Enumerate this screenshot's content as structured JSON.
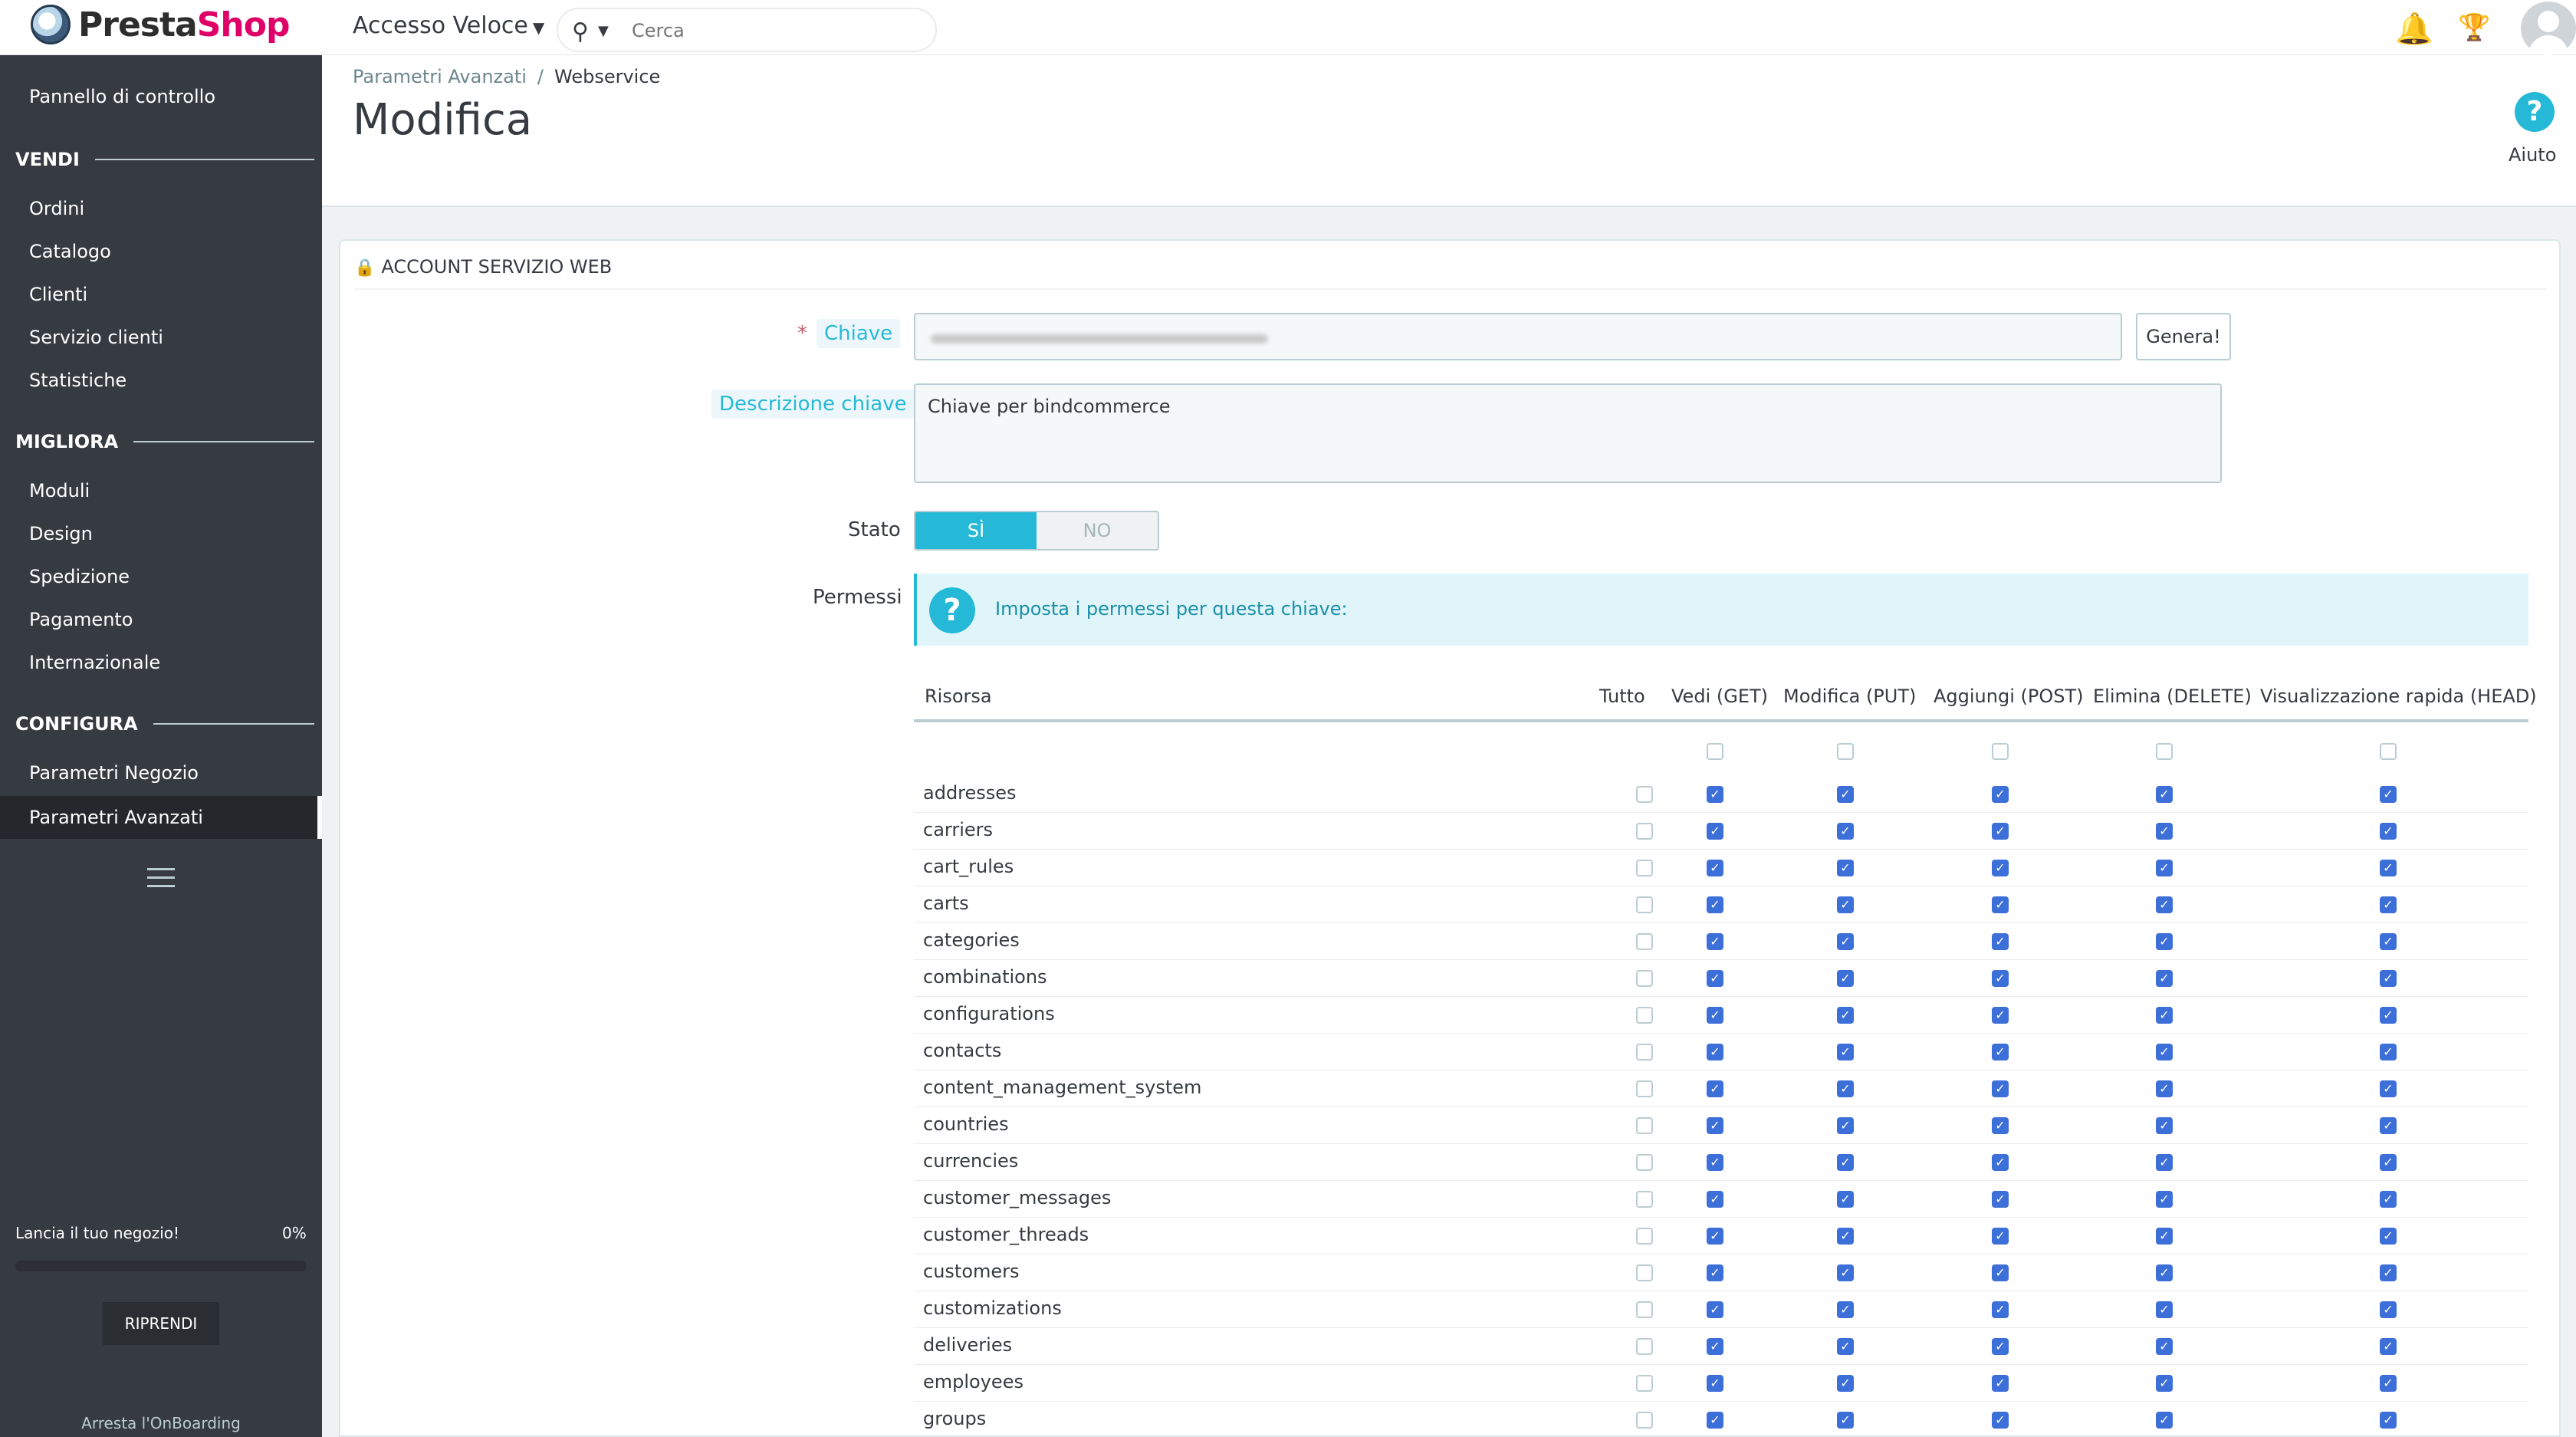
{
  "header": {
    "logo_text_a": "Presta",
    "logo_text_b": "Shop",
    "quick_access": "Accesso Veloce",
    "search_placeholder": "Cerca"
  },
  "sidebar": {
    "dashboard": "Pannello di controllo",
    "sections": [
      {
        "title": "VENDI",
        "items": [
          "Ordini",
          "Catalogo",
          "Clienti",
          "Servizio clienti",
          "Statistiche"
        ]
      },
      {
        "title": "MIGLIORA",
        "items": [
          "Moduli",
          "Design",
          "Spedizione",
          "Pagamento",
          "Internazionale"
        ]
      },
      {
        "title": "CONFIGURA",
        "items": [
          "Parametri Negozio",
          "Parametri Avanzati"
        ]
      }
    ],
    "active_item": "Parametri Avanzati",
    "onboarding": {
      "label": "Lancia il tuo negozio!",
      "percent": "0%",
      "progress": 0,
      "resume": "RIPRENDI",
      "stop": "Arresta l'OnBoarding"
    }
  },
  "page": {
    "breadcrumb": [
      "Parametri Avanzati",
      "Webservice"
    ],
    "title": "Modifica",
    "help": "Aiuto"
  },
  "form": {
    "panel_title": "ACCOUNT SERVIZIO WEB",
    "key_label": "Chiave",
    "generate": "Genera!",
    "desc_label": "Descrizione chiave",
    "desc_value": "Chiave per bindcommerce",
    "status_label": "Stato",
    "status_yes": "SÌ",
    "status_no": "NO",
    "status_value": "yes",
    "perm_label": "Permessi",
    "perm_info": "Imposta i permessi per questa chiave:"
  },
  "permissions": {
    "columns": [
      "Risorsa",
      "Tutto",
      "Vedi (GET)",
      "Modifica (PUT)",
      "Aggiungi (POST)",
      "Elimina (DELETE)",
      "Visualizzazione rapida (HEAD)"
    ],
    "resources": [
      "addresses",
      "carriers",
      "cart_rules",
      "carts",
      "categories",
      "combinations",
      "configurations",
      "contacts",
      "content_management_system",
      "countries",
      "currencies",
      "customer_messages",
      "customer_threads",
      "customers",
      "customizations",
      "deliveries",
      "employees",
      "groups"
    ],
    "row_state": {
      "all": false,
      "get": true,
      "put": true,
      "post": true,
      "delete": true,
      "head": true
    }
  },
  "colors": {
    "accent": "#25b9d7",
    "sidebar": "#363a41",
    "checkbox_on": "#3d6fd8"
  }
}
